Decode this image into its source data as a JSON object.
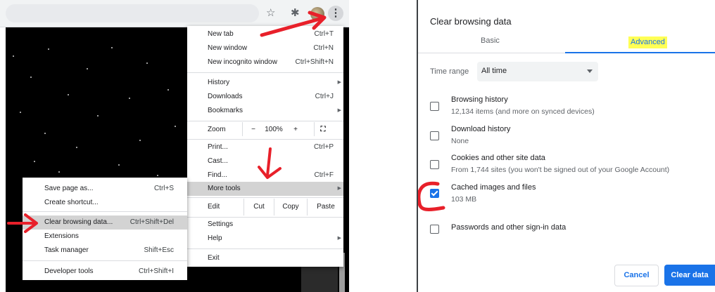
{
  "toolbar": {
    "star_icon": "star-icon",
    "puzzle_icon": "puzzle-icon",
    "menu_icon": "vertical-dots-icon"
  },
  "main_menu": {
    "new_tab": "New tab",
    "new_tab_sc": "Ctrl+T",
    "new_window": "New window",
    "new_window_sc": "Ctrl+N",
    "new_incognito": "New incognito window",
    "new_incognito_sc": "Ctrl+Shift+N",
    "history": "History",
    "downloads": "Downloads",
    "downloads_sc": "Ctrl+J",
    "bookmarks": "Bookmarks",
    "zoom": "Zoom",
    "zoom_minus": "−",
    "zoom_value": "100%",
    "zoom_plus": "+",
    "print": "Print...",
    "print_sc": "Ctrl+P",
    "cast": "Cast...",
    "find": "Find...",
    "find_sc": "Ctrl+F",
    "more_tools": "More tools",
    "edit": "Edit",
    "cut": "Cut",
    "copy": "Copy",
    "paste": "Paste",
    "settings": "Settings",
    "help": "Help",
    "exit": "Exit"
  },
  "sub_menu": {
    "save_page": "Save page as...",
    "save_page_sc": "Ctrl+S",
    "create_shortcut": "Create shortcut...",
    "clear_data": "Clear browsing data...",
    "clear_data_sc": "Ctrl+Shift+Del",
    "extensions": "Extensions",
    "task_manager": "Task manager",
    "task_manager_sc": "Shift+Esc",
    "dev_tools": "Developer tools",
    "dev_tools_sc": "Ctrl+Shift+I"
  },
  "dialog": {
    "title": "Clear browsing data",
    "tabs": [
      "Basic",
      "Advanced"
    ],
    "active_tab": "Advanced",
    "time_range_label": "Time range",
    "time_range_value": "All time",
    "options": [
      {
        "title": "Browsing history",
        "subtitle": "12,134 items (and more on synced devices)",
        "checked": false
      },
      {
        "title": "Download history",
        "subtitle": "None",
        "checked": false
      },
      {
        "title": "Cookies and other site data",
        "subtitle": "From 1,744 sites (you won't be signed out of your Google Account)",
        "checked": false
      },
      {
        "title": "Cached images and files",
        "subtitle": "103 MB",
        "checked": true
      },
      {
        "title": "Passwords and other sign-in data",
        "subtitle": "",
        "checked": false
      }
    ],
    "cancel": "Cancel",
    "clear": "Clear data"
  },
  "colors": {
    "accent": "#1a73e8",
    "annotation": "#e8202a",
    "highlight": "#ffff55"
  }
}
